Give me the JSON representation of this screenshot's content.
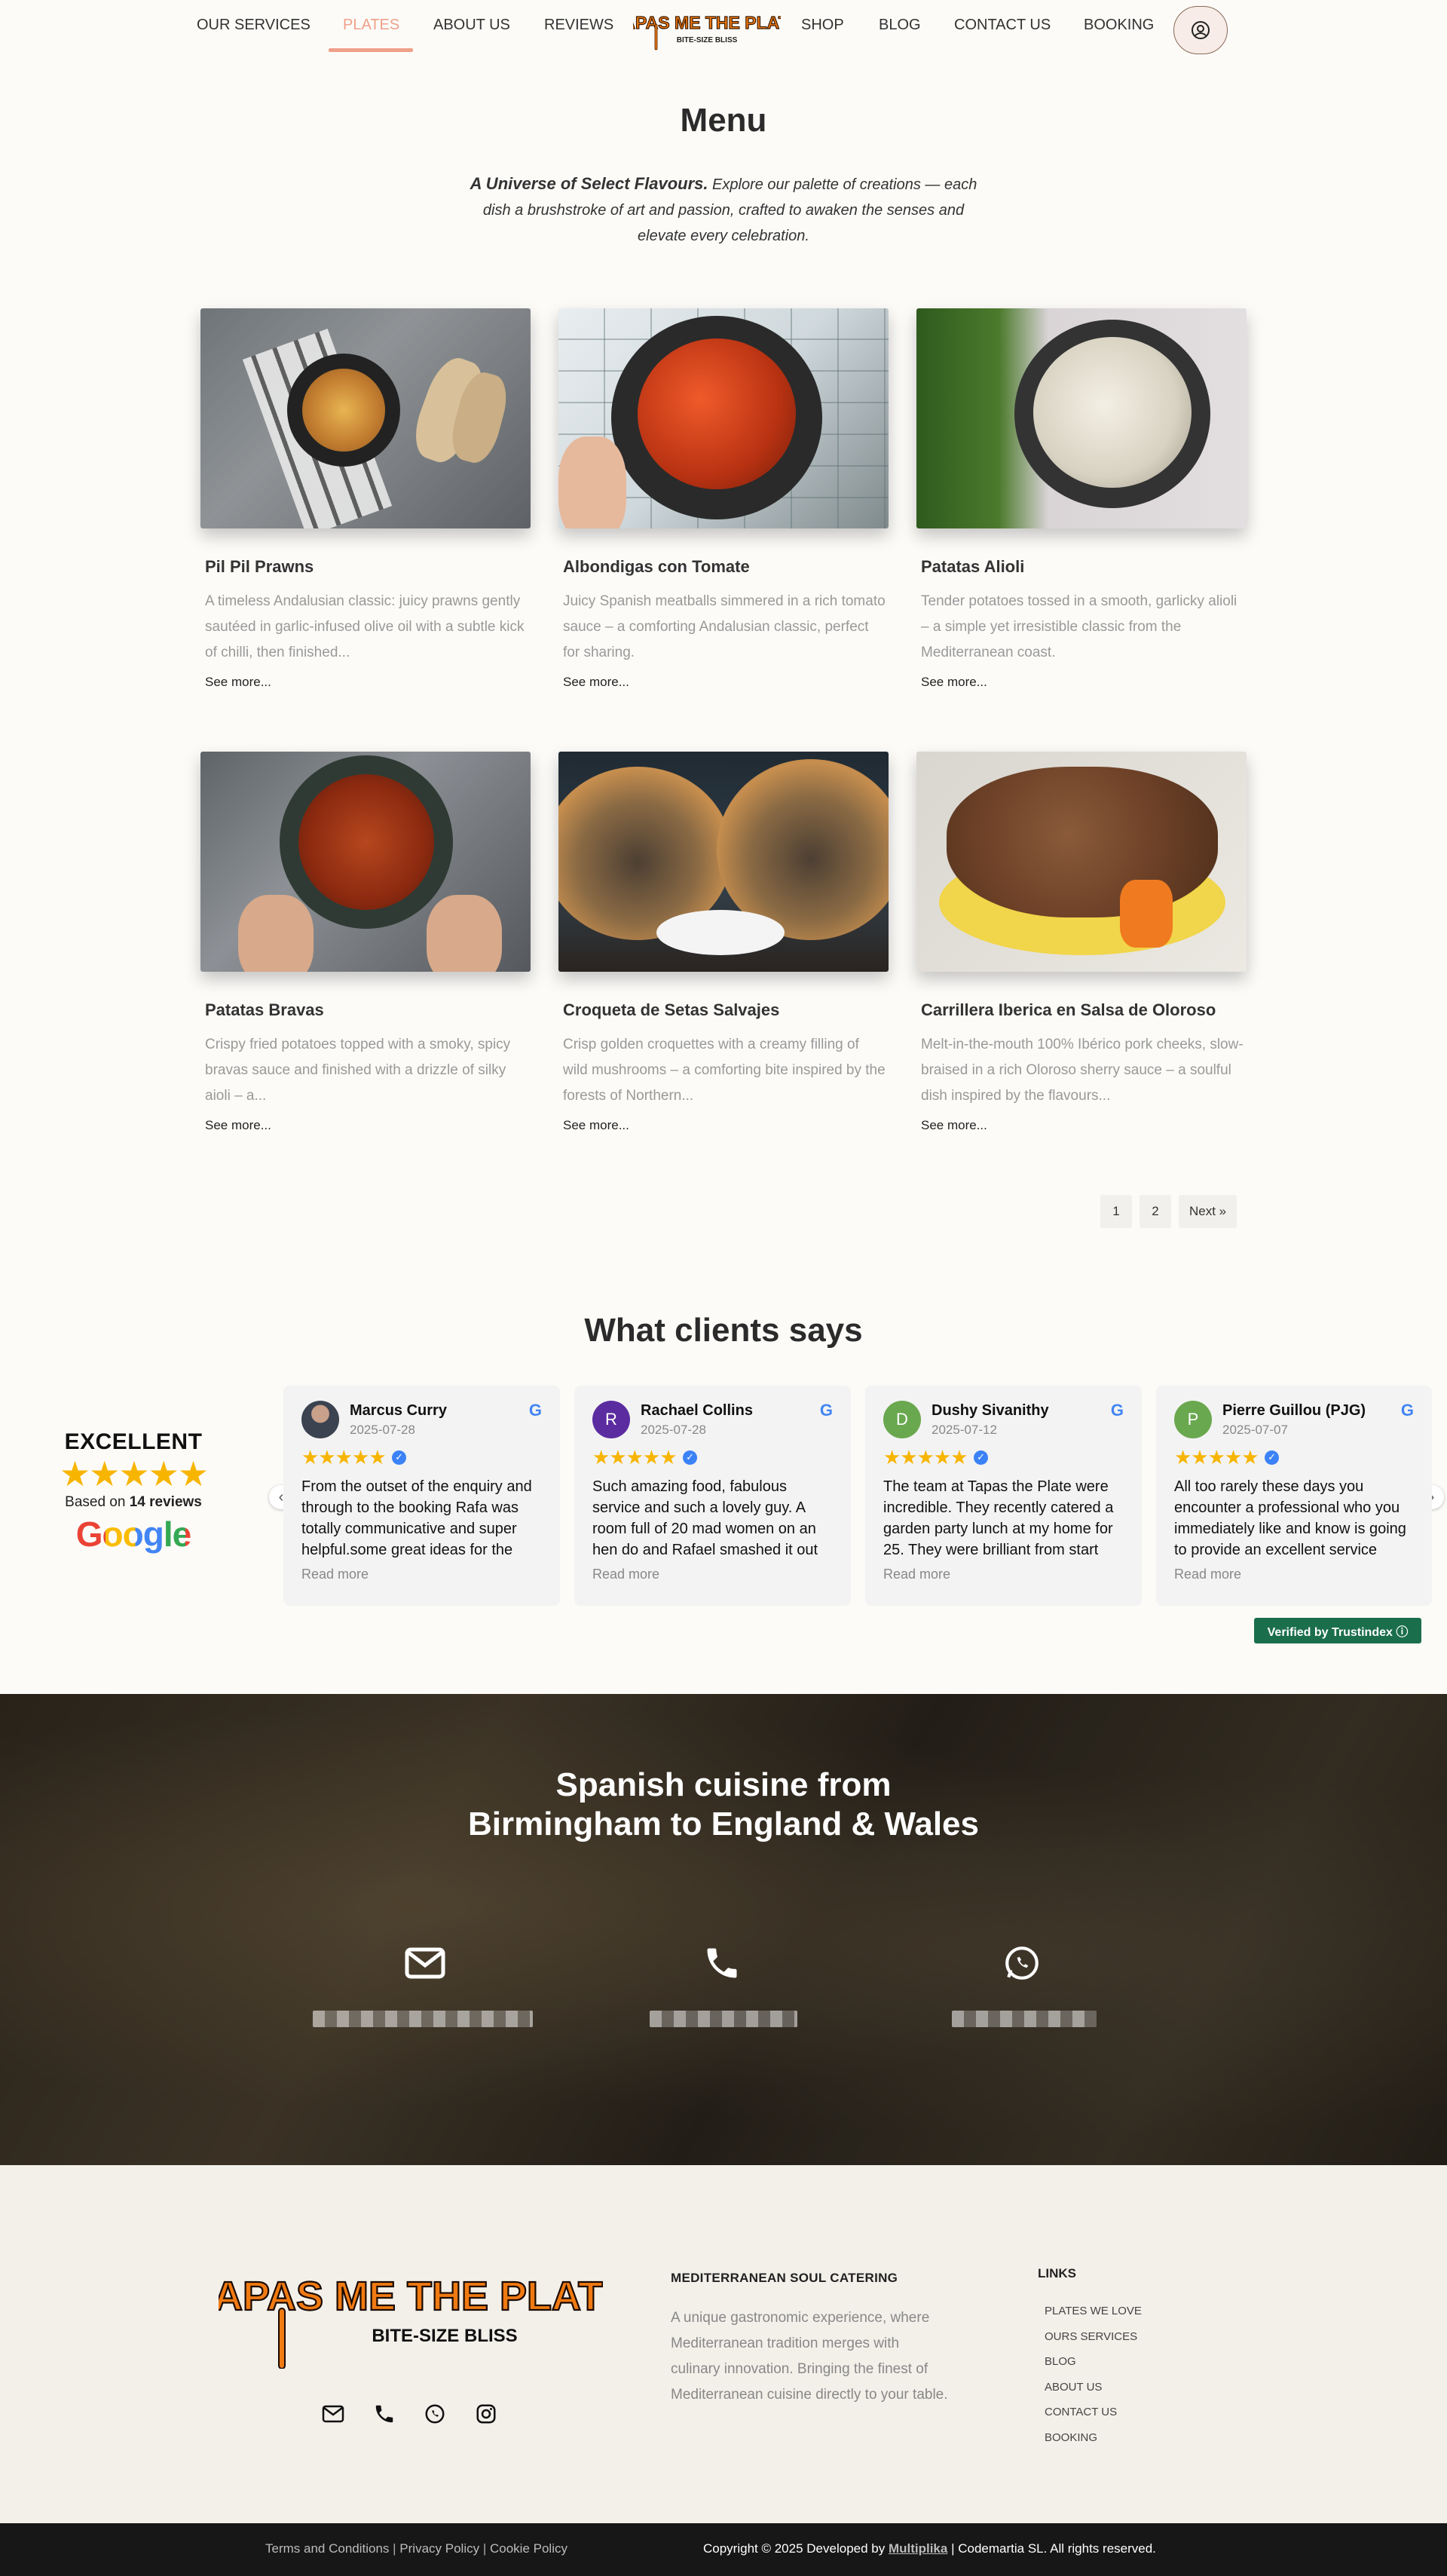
{
  "nav": {
    "items": [
      {
        "label": "OUR SERVICES"
      },
      {
        "label": "PLATES"
      },
      {
        "label": "ABOUT US"
      },
      {
        "label": "REVIEWS"
      },
      {
        "label": "SHOP"
      },
      {
        "label": "BLOG"
      },
      {
        "label": "CONTACT US"
      },
      {
        "label": "BOOKING"
      }
    ],
    "logo_main": "TAPAS ME THE PLATE",
    "logo_sub": "BITE-SIZE BLISS",
    "user_icon": "user-circle-icon"
  },
  "menu": {
    "title": "Menu",
    "intro_bold": "A Universe of Select Flavours.",
    "intro_text": " Explore our palette of creations — each dish a brushstroke of art and passion, crafted to awaken the senses and elevate every celebration.",
    "see_more": "See more...",
    "dishes": [
      {
        "title": "Pil Pil Prawns",
        "desc": "A timeless Andalusian classic: juicy prawns gently sautéed in garlic-infused olive oil with a subtle kick of chilli, then finished..."
      },
      {
        "title": "Albondigas con Tomate",
        "desc": "Juicy Spanish meatballs simmered in a rich tomato sauce – a comforting Andalusian classic, perfect for sharing."
      },
      {
        "title": "Patatas Alioli",
        "desc": "Tender potatoes tossed in a smooth, garlicky alioli – a simple yet irresistible classic from the Mediterranean coast."
      },
      {
        "title": "Patatas Bravas",
        "desc": "Crispy fried potatoes topped with a smoky, spicy bravas sauce and finished with a drizzle of silky aioli – a..."
      },
      {
        "title": "Croqueta de Setas Salvajes",
        "desc": "Crisp golden croquettes with a creamy filling of wild mushrooms – a comforting bite inspired by the forests of Northern..."
      },
      {
        "title": "Carrillera Iberica en Salsa de Oloroso",
        "desc": "Melt-in-the-mouth 100% Ibérico pork cheeks, slow-braised in a rich Oloroso sherry sauce – a soulful dish inspired by the flavours..."
      }
    ],
    "pagination": [
      "1",
      "2",
      "Next »"
    ]
  },
  "reviews": {
    "title": "What clients says",
    "summary": {
      "rating_word": "EXCELLENT",
      "stars": "★★★★★",
      "based_prefix": "Based on ",
      "based_count": "14 reviews",
      "google": "Google"
    },
    "read_more": "Read more",
    "items": [
      {
        "name": "Marcus Curry",
        "date": "2025-07-28",
        "initial": "",
        "avatar_color": "#4a5568",
        "text": "From the outset of the enquiry and through to the booking Rafa was totally communicative and super helpful.some great ideas for the menu"
      },
      {
        "name": "Rachael Collins",
        "date": "2025-07-28",
        "initial": "R",
        "avatar_color": "#5b2ca0",
        "text": "Such amazing food, fabulous service and such a lovely guy. A room full of 20 mad women on an hen do and Rafael smashed it out the park"
      },
      {
        "name": "Dushy Sivanithy",
        "date": "2025-07-12",
        "initial": "D",
        "avatar_color": "#6aa84f",
        "text": "The team at Tapas the Plate were incredible. They recently catered a garden party lunch at my home for 25. They were brilliant from start"
      },
      {
        "name": "Pierre Guillou (PJG)",
        "date": "2025-07-07",
        "initial": "P",
        "avatar_color": "#6aa84f",
        "text": "All too rarely these days you encounter a professional who you immediately like and know is going to provide an excellent service"
      }
    ],
    "verified": "Verified by Trustindex ⓘ"
  },
  "hero": {
    "title_line1": "Spanish cuisine from",
    "title_line2": "Birmingham to England & Wales",
    "icons": [
      "envelope-icon",
      "phone-icon",
      "whatsapp-icon"
    ]
  },
  "footer": {
    "logo_main": "TAPAS ME THE PLATE",
    "logo_sub": "BITE-SIZE BLISS",
    "about_heading": "MEDITERRANEAN SOUL CATERING",
    "about_text": "A unique gastronomic experience, where Mediterranean tradition merges with culinary innovation. Bringing the finest of Mediterranean cuisine directly to your table.",
    "links_heading": "LINKS",
    "links": [
      "PLATES WE LOVE",
      "OURS SERVICES",
      "BLOG",
      "ABOUT US",
      "CONTACT US",
      "BOOKING"
    ],
    "social": [
      "envelope-icon",
      "phone-icon",
      "whatsapp-icon",
      "instagram-icon"
    ]
  },
  "bottom_bar": {
    "terms": "Terms and Conditions",
    "privacy": "Privacy Policy",
    "cookie": "Cookie Policy",
    "sep": " | ",
    "copyright_prefix": "Copyright © 2025 Developed by ",
    "developer": "Multiplika",
    "copyright_suffix": " | Codemartia SL. All rights reserved."
  },
  "colors": {
    "accent": "#f0a08a",
    "brand_orange": "#f07a12",
    "star": "#f7b500",
    "trust_green": "#1b6e4c"
  }
}
